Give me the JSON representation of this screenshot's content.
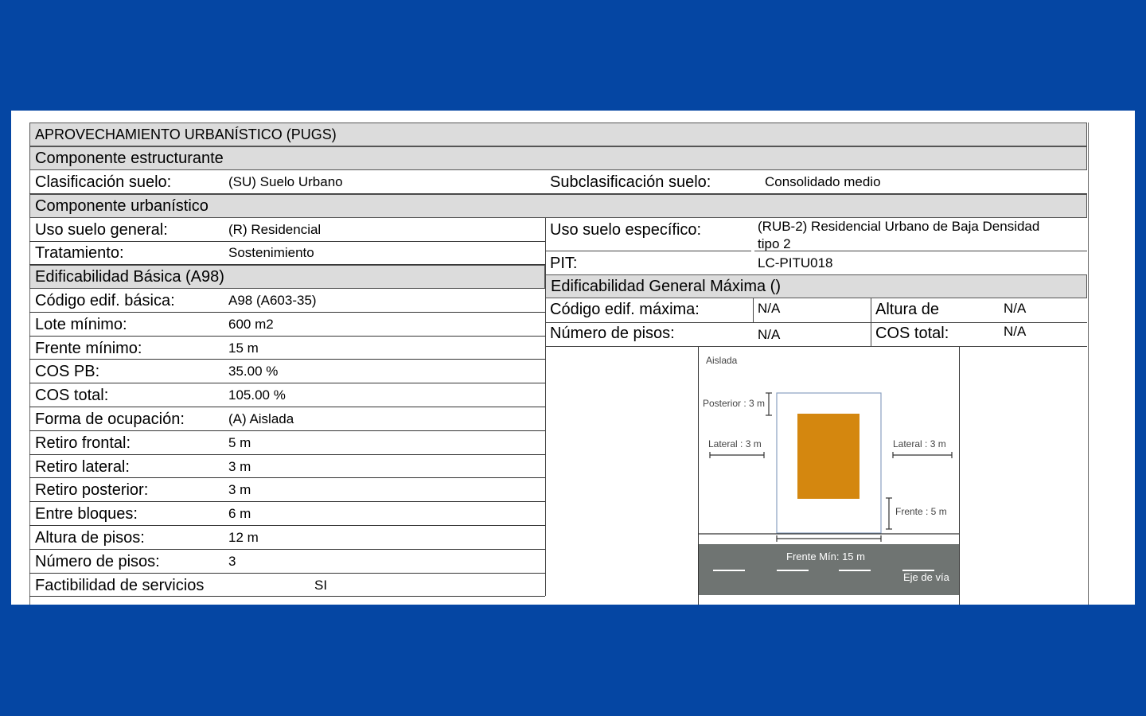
{
  "header": "APROVECHAMIENTO URBANÍSTICO (PUGS)",
  "sections": {
    "estructurante": "Componente  estructurante",
    "urbanistico": "Componente  urbanístico",
    "basica": "Edificabilidad Básica (A98)",
    "maxima": "Edificabilidad General Máxima ()"
  },
  "estructurante": {
    "clasificacion_label": "Clasificación suelo:",
    "clasificacion_value": "(SU) Suelo Urbano",
    "subclasificacion_label": "Subclasificación suelo:",
    "subclasificacion_value": "Consolidado medio"
  },
  "urbanistico": {
    "uso_general_label": "Uso suelo general:",
    "uso_general_value": "(R) Residencial",
    "tratamiento_label": "Tratamiento:",
    "tratamiento_value": "Sostenimiento",
    "uso_especifico_label": "Uso suelo específico:",
    "uso_especifico_value_1": "(RUB-2) Residencial Urbano de Baja Densidad",
    "uso_especifico_value_2": "tipo 2",
    "pit_label": "PIT:",
    "pit_value": "LC-PITU018"
  },
  "basica_rows": [
    {
      "label": "Código edif. básica:",
      "value": "A98 (A603-35)"
    },
    {
      "label": "Lote mínimo:",
      "value": "600 m2"
    },
    {
      "label": "Frente mínimo:",
      "value": "15 m"
    },
    {
      "label": "COS PB:",
      "value": "35.00 %"
    },
    {
      "label": "COS total:",
      "value": "105.00 %"
    },
    {
      "label": "Forma de ocupación:",
      "value": "(A) Aislada"
    },
    {
      "label": "Retiro frontal:",
      "value": "5 m"
    },
    {
      "label": "Retiro lateral:",
      "value": "3 m"
    },
    {
      "label": "Retiro posterior:",
      "value": "3 m"
    },
    {
      "label": "Entre bloques:",
      "value": "6 m"
    },
    {
      "label": "Altura de pisos:",
      "value": "12 m"
    },
    {
      "label": "Número de pisos:",
      "value": "3"
    },
    {
      "label": "Factibilidad de servicios",
      "value": "SI"
    }
  ],
  "maxima": {
    "codigo_label": "Código edif. máxima:",
    "codigo_value": "N/A",
    "altura_label": "Altura de",
    "altura_value": "N/A",
    "pisos_label": "Número de pisos:",
    "pisos_value": "N/A",
    "cos_label": "COS total:",
    "cos_value": "N/A"
  },
  "diagram": {
    "title": "Aislada",
    "posterior": "Posterior : 3 m",
    "lateral_left": "Lateral : 3 m",
    "lateral_right": "Lateral : 3 m",
    "frente": "Frente : 5 m",
    "frente_min": "Frente Mín: 15 m",
    "eje": "Eje de vía",
    "building_color": "#d4870f",
    "road_color": "#6f7472"
  }
}
